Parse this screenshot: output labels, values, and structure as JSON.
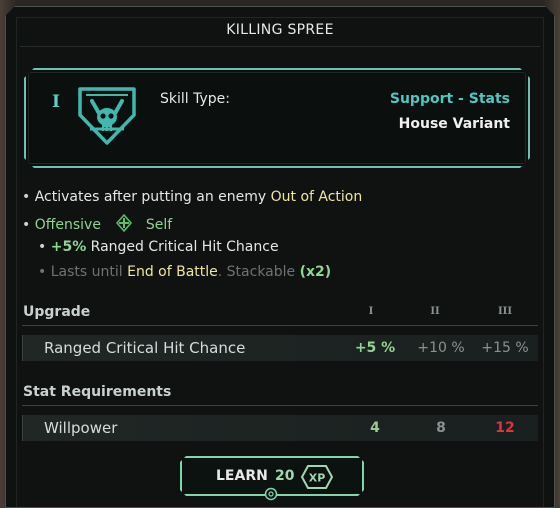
{
  "title": "KILLING SPREE",
  "skill": {
    "tier": "I",
    "type_label": "Skill Type:",
    "type_value": "Support - Stats",
    "variant": "House Variant",
    "icon": "skull-crossed-blades-icon"
  },
  "description": {
    "line1": {
      "bullet": "•",
      "text": "Activates after putting an enemy",
      "highlight": "Out of Action"
    },
    "line2": {
      "bullet": "•",
      "tag1": "Offensive",
      "tag2": "Self",
      "icon": "diamond-arrows-icon"
    },
    "line3": {
      "bullet": "•",
      "value": "+5%",
      "text": "Ranged Critical Hit Chance"
    },
    "line4": {
      "bullet": "•",
      "prefix": "Lasts until",
      "highlight": "End of Battle",
      "suffix": ". Stackable",
      "count": "(x2)"
    }
  },
  "upgrade": {
    "header": "Upgrade",
    "columns": [
      "I",
      "II",
      "III"
    ],
    "rows": [
      {
        "label": "Ranged Critical Hit Chance",
        "values": [
          "+5 %",
          "+10 %",
          "+15 %"
        ]
      }
    ]
  },
  "requirements": {
    "header": "Stat Requirements",
    "rows": [
      {
        "label": "Willpower",
        "values": [
          "4",
          "8",
          "12"
        ]
      }
    ]
  },
  "learn": {
    "label": "LEARN",
    "cost": "20",
    "currency": "XP"
  },
  "colors": {
    "accent_teal": "#4fc6bf",
    "highlight_yellow": "#f1e79a",
    "positive_green": "#8fd48f",
    "insufficient_red": "#e0333a"
  }
}
